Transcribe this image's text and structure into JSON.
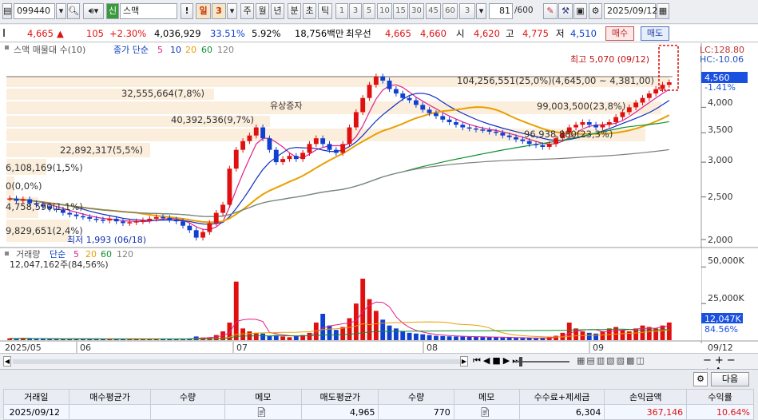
{
  "toolbar": {
    "code": "099440",
    "name": "스맥",
    "period_buttons": [
      "일",
      "3",
      "주",
      "월",
      "년",
      "분",
      "초",
      "틱",
      "1",
      "3",
      "5",
      "10",
      "15",
      "30",
      "45",
      "60",
      "3"
    ],
    "selected_period": "일",
    "count_current": "81",
    "count_total": "/600",
    "date": "2025/09/12",
    "jong_label": "신"
  },
  "quote": {
    "price": "4,665",
    "arrow": "▲",
    "change": "105",
    "change_pct": "+2.30%",
    "volume": "4,036,929",
    "volume_ratio": "33.51%",
    "turnover": "5.92%",
    "amount": "18,756백만",
    "best_label": "최우선",
    "ask": "4,665",
    "bid": "4,660",
    "open_label": "시",
    "open": "4,620",
    "high_label": "고",
    "high": "4,775",
    "low_label": "저",
    "low": "4,510",
    "buy_label": "매수",
    "sell_label": "매도"
  },
  "legend": {
    "title": "스맥 매물대 수(10)",
    "ma_label": "종가 단순",
    "ma_periods": [
      "5",
      "10",
      "20",
      "60",
      "120"
    ],
    "ma_colors": [
      "#e0208a",
      "#1030c0",
      "#e8a000",
      "#109030",
      "#808080"
    ],
    "lc": "LC:128.80",
    "hc": "HC:-10.06"
  },
  "price_axis": {
    "ticks": [
      "4,000",
      "3,500",
      "3,000",
      "2,500",
      "2,000"
    ],
    "current": "4,560",
    "current_pct": "-1.41%"
  },
  "volume_profile": [
    {
      "label": "104,256,551(25,0%)(4,645,00 ~ 4,381,00)"
    },
    {
      "label": "32,555,664(7,8%)"
    },
    {
      "label": "99,003,500(23,8%)"
    },
    {
      "label": "40,392,536(9,7%)"
    },
    {
      "label": "96,938,880(23,3%)"
    },
    {
      "label": "22,892,317(5,5%)"
    },
    {
      "label": "6,108,169(1,5%)"
    },
    {
      "label": "0(0,0%)"
    },
    {
      "label": "4,758,590(1,1%)"
    },
    {
      "label": "9,829,651(2,4%)"
    }
  ],
  "annotations": {
    "high": "최고 5,070 (09/12)",
    "low": "최저 1,993 (06/18)",
    "event": "유상증자"
  },
  "volume_pane": {
    "title": "거래량",
    "ma_label": "단순",
    "ma_periods": [
      "5",
      "20",
      "60",
      "120"
    ],
    "info": "12,047,162주(84,56%)",
    "ticks": [
      "50,000K",
      "25,000K"
    ],
    "current": "12,047K",
    "current_pct": "84.56%"
  },
  "date_axis": {
    "labels": [
      "2025/05",
      "06",
      "07",
      "08",
      "09"
    ],
    "right_label": "09/12"
  },
  "nav": {
    "next_label": "다음"
  },
  "pl_table": {
    "headers": [
      "거래일",
      "매수평균가",
      "수량",
      "메모",
      "매도평균가",
      "수량",
      "메모",
      "수수료+제세금",
      "손익금액",
      "수익률"
    ],
    "row": [
      "2025/09/12",
      "",
      "",
      "",
      "4,965",
      "770",
      "",
      "6,304",
      "367,146",
      "10.64%"
    ]
  },
  "chart_data": {
    "type": "candlestick",
    "title": "스맥",
    "x": [
      "2025/05",
      "06",
      "07",
      "08",
      "09",
      "09/12"
    ],
    "y_ticks": [
      2000,
      2500,
      3000,
      3500,
      4000
    ],
    "ylim": [
      1950,
      5150
    ],
    "high": {
      "value": 5070,
      "date": "09/12"
    },
    "low": {
      "value": 1993,
      "date": "06/18"
    },
    "last_price": 4560,
    "closes": [
      2480,
      2450,
      2470,
      2420,
      2400,
      2380,
      2350,
      2340,
      2300,
      2280,
      2260,
      2250,
      2230,
      2220,
      2210,
      2230,
      2200,
      2180,
      2190,
      2200,
      2210,
      2230,
      2250,
      2240,
      2220,
      2200,
      2150,
      2100,
      2020,
      2080,
      2180,
      2300,
      2400,
      2900,
      3200,
      3350,
      3450,
      3600,
      3400,
      3200,
      3000,
      3050,
      3100,
      3050,
      3150,
      3300,
      3400,
      3300,
      3200,
      3150,
      3300,
      3600,
      3900,
      4200,
      4500,
      4700,
      4600,
      4400,
      4300,
      4200,
      4150,
      4050,
      3950,
      3880,
      3820,
      3750,
      3700,
      3650,
      3600,
      3580,
      3560,
      3550,
      3520,
      3500,
      3450,
      3420,
      3380,
      3350,
      3300,
      3280,
      3250,
      3300,
      3400,
      3500,
      3600,
      3650,
      3700,
      3650,
      3600,
      3650,
      3700,
      3800,
      3900,
      4000,
      4100,
      4200,
      4300,
      4400,
      4500,
      4560
    ],
    "volume_ylim": [
      0,
      60000
    ],
    "volume_ticks": [
      25000,
      50000
    ],
    "volumes": [
      1200,
      1000,
      1500,
      900,
      800,
      1100,
      900,
      700,
      600,
      800,
      1000,
      900,
      700,
      800,
      600,
      700,
      900,
      800,
      700,
      600,
      800,
      1000,
      900,
      800,
      700,
      600,
      900,
      1200,
      2500,
      1800,
      2000,
      3500,
      6000,
      12000,
      40000,
      8000,
      6000,
      5000,
      4500,
      3000,
      3500,
      2500,
      2000,
      2800,
      3500,
      5000,
      12000,
      18000,
      10000,
      7000,
      9000,
      15000,
      25000,
      42000,
      28000,
      20000,
      14000,
      10000,
      8000,
      6000,
      5000,
      4500,
      4000,
      3500,
      3000,
      2800,
      2600,
      2500,
      2400,
      2300,
      2200,
      2100,
      2000,
      1900,
      1800,
      1700,
      1600,
      1500,
      1400,
      1300,
      1500,
      2000,
      3000,
      5000,
      12000,
      8000,
      6000,
      5000,
      4500,
      6000,
      8000,
      9000,
      7000,
      6000,
      8000,
      10000,
      9000,
      8000,
      10000,
      12047
    ]
  }
}
